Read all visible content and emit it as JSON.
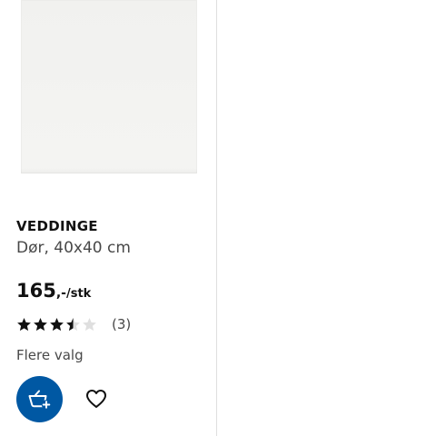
{
  "product": {
    "name": "VEDDINGE",
    "description": "Dør, 40x40 cm",
    "price": {
      "integer": "165",
      "suffix": ",-",
      "unit": "/stk"
    },
    "rating": {
      "value": 3.5,
      "max": 5,
      "reviews_label": "(3)"
    },
    "options_label": "Flere valg"
  },
  "actions": {
    "cart_icon": "basket-plus-icon",
    "wishlist_icon": "heart-icon"
  },
  "colors": {
    "brand_blue": "#0058a3",
    "star_filled": "#111111",
    "star_empty": "#dfdfdf",
    "divider": "#dfdfdf"
  }
}
